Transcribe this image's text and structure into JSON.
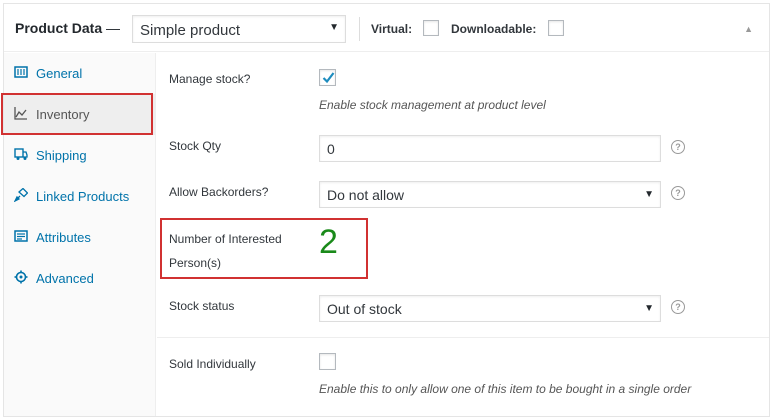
{
  "header": {
    "title": "Product Data",
    "dash": "—",
    "product_type": "Simple product",
    "virtual_label": "Virtual:",
    "downloadable_label": "Downloadable:"
  },
  "sidebar": {
    "items": [
      {
        "label": "General",
        "icon": "general-icon"
      },
      {
        "label": "Inventory",
        "icon": "inventory-icon"
      },
      {
        "label": "Shipping",
        "icon": "shipping-icon"
      },
      {
        "label": "Linked Products",
        "icon": "linked-products-icon"
      },
      {
        "label": "Attributes",
        "icon": "attributes-icon"
      },
      {
        "label": "Advanced",
        "icon": "advanced-icon"
      }
    ],
    "active": "Inventory"
  },
  "inventory": {
    "manage_stock_label": "Manage stock?",
    "manage_stock_checked": true,
    "manage_stock_desc": "Enable stock management at product level",
    "stock_qty_label": "Stock Qty",
    "stock_qty_value": "0",
    "backorders_label": "Allow Backorders?",
    "backorders_value": "Do not allow",
    "interested_label_line1": "Number of Interested",
    "interested_label_line2": "Person(s)",
    "interested_value": "2",
    "stock_status_label": "Stock status",
    "stock_status_value": "Out of stock",
    "sold_individually_label": "Sold Individually",
    "sold_individually_checked": false,
    "sold_individually_desc": "Enable this to only allow one of this item to be bought in a single order"
  },
  "icons": {
    "help": "?",
    "select_arrow": "▼",
    "collapse": "▲"
  },
  "colors": {
    "link": "#0073aa",
    "highlight_box": "#d13131",
    "interested_value": "#1a8a1a"
  }
}
